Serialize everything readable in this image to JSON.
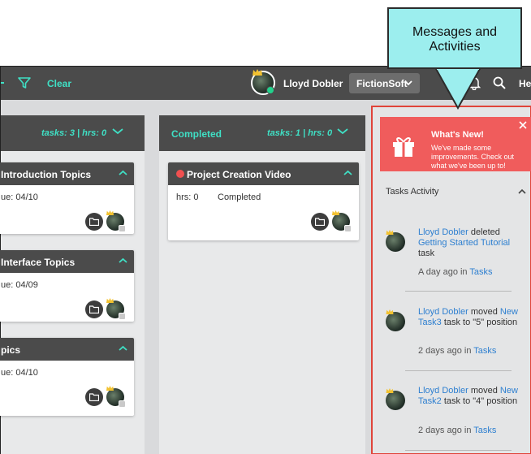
{
  "topbar": {
    "clear_label": "Clear",
    "user_name": "Lloyd Dobler",
    "org_label": "FictionSoft",
    "help_label": "He"
  },
  "columns": [
    {
      "title": "",
      "stats": "tasks: 3 | hrs: 0",
      "cards": [
        {
          "title": "Introduction Topics",
          "meta": "ue: 04/10"
        },
        {
          "title": "Interface Topics",
          "meta": "ue: 04/09"
        },
        {
          "title": "pics",
          "meta": "ue: 04/10"
        }
      ]
    },
    {
      "title": "Completed",
      "stats": "tasks: 1 | hrs: 0",
      "cards": [
        {
          "title": "Project Creation Video",
          "hrs": "hrs: 0",
          "status": "Completed"
        }
      ]
    }
  ],
  "whats_new": {
    "title": "What's New!",
    "text": "We've made some improvements. Check out what we've been up to!"
  },
  "activity": {
    "title": "Tasks Activity",
    "items": [
      {
        "user": "Lloyd Dobler",
        "action": "deleted",
        "link": "Getting Started Tutorial",
        "tail": "task",
        "time": "A day ago in",
        "place": "Tasks"
      },
      {
        "user": "Lloyd Dobler",
        "action": "moved",
        "link": "New Task3",
        "tail": "task to \"5\" position",
        "time": "2 days ago in",
        "place": "Tasks"
      },
      {
        "user": "Lloyd Dobler",
        "action": "moved",
        "link": "New Task2",
        "tail": "task to \"4\" position",
        "time": "2 days ago in",
        "place": "Tasks"
      }
    ]
  },
  "callout": {
    "text": "Messages and Activities"
  },
  "colors": {
    "accent": "#3fe0c5",
    "bar": "#4b4b4b",
    "alert": "#f05c5c",
    "callout": "#9ceeee",
    "link": "#2d7fd0"
  },
  "icons": [
    "filter-icon",
    "bell-icon",
    "search-icon",
    "chevron-down-icon",
    "folder-icon",
    "gift-icon",
    "close-icon",
    "crown-icon"
  ]
}
